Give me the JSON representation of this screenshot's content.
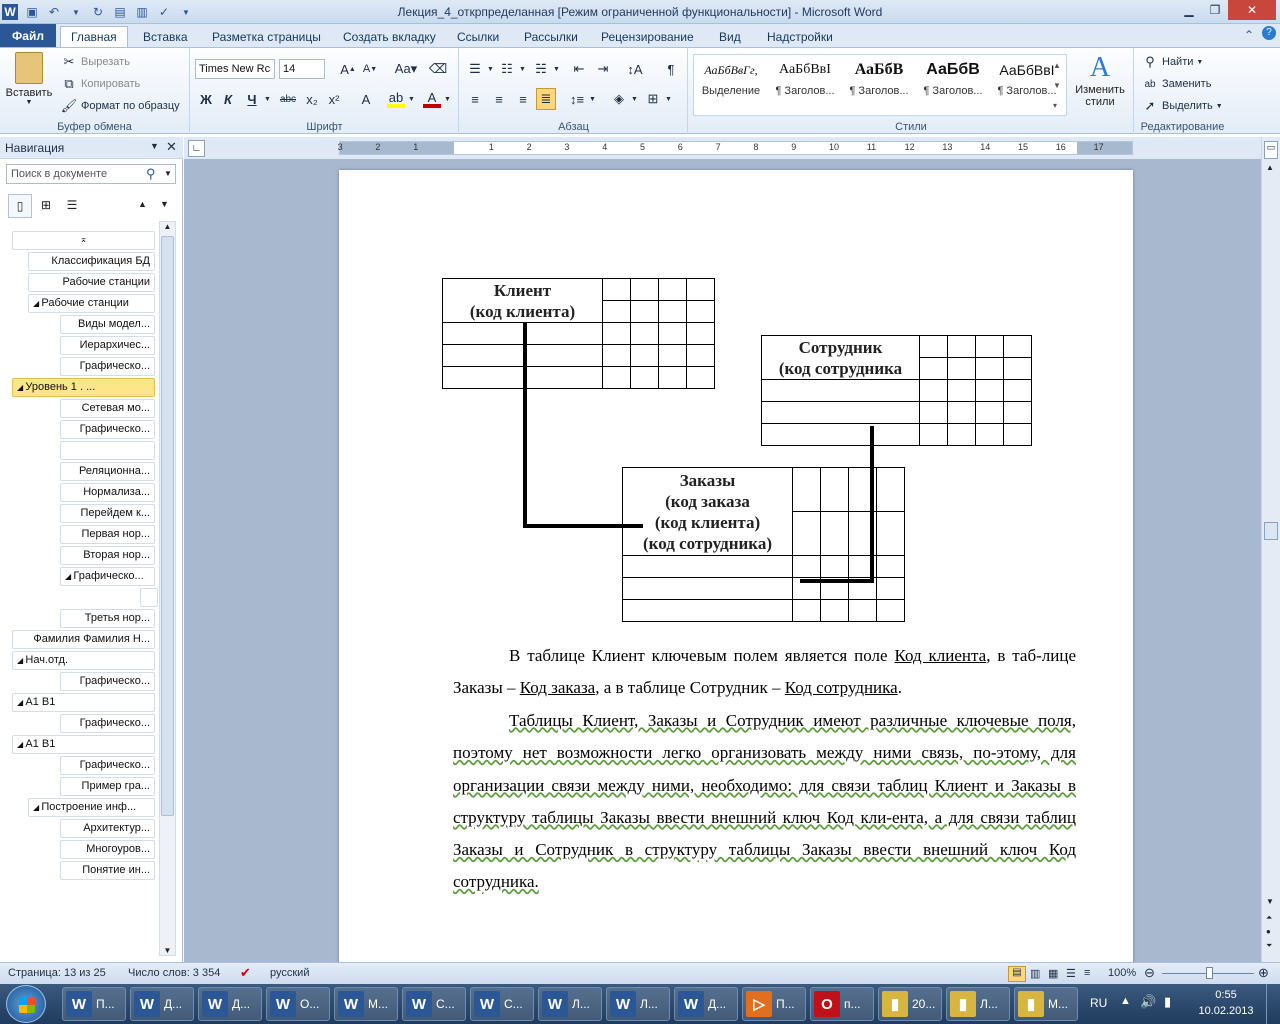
{
  "window": {
    "title": "Лекция_4_открпределанная [Режим ограниченной функциональности] - Microsoft Word"
  },
  "tabs": [
    "Файл",
    "Главная",
    "Вставка",
    "Разметка страницы",
    "Создать вкладку",
    "Ссылки",
    "Рассылки",
    "Рецензирование",
    "Вид",
    "Надстройки"
  ],
  "ribbon": {
    "clipboard": {
      "paste": "Вставить",
      "cut": "Вырезать",
      "copy": "Копировать",
      "format_painter": "Формат по образцу",
      "label": "Буфер обмена"
    },
    "font": {
      "name": "Times New Rc",
      "size": "14",
      "label": "Шрифт"
    },
    "paragraph": {
      "label": "Абзац"
    },
    "styles": {
      "label": "Стили",
      "items": [
        {
          "sample": "АаБбВвГг,",
          "name": "Выделение"
        },
        {
          "sample": "АаБбВвI",
          "name": "¶ Заголов..."
        },
        {
          "sample": "АаБбВ",
          "name": "¶ Заголов..."
        },
        {
          "sample": "АаБбВ",
          "name": "¶ Заголов..."
        },
        {
          "sample": "АаБбВвI",
          "name": "¶ Заголов..."
        }
      ],
      "change": "Изменить стили"
    },
    "editing": {
      "find": "Найти",
      "replace": "Заменить",
      "select": "Выделить",
      "label": "Редактирование"
    }
  },
  "nav": {
    "title": "Навигация",
    "search_placeholder": "Поиск в документе",
    "items": [
      "Классификация БД",
      "Рабочие станции",
      "Рабочие станции",
      "Виды модел...",
      "Иерархичес...",
      "Графическо...",
      "Уровень 1          .         ...",
      "Сетевая мо...",
      "Графическо...",
      "",
      "Реляционна...",
      "Нормализа...",
      "Перейдем к...",
      "Первая нор...",
      "Вторая нор...",
      "Графическо...",
      "",
      "Третья нор...",
      "Фамилия Фамилия Н...",
      "Нач.отд.",
      "Графическо...",
      "А1 В1",
      "Графическо...",
      "А1 В1",
      "Графическо...",
      "Пример гра...",
      "Построение инф...",
      "Архитектур...",
      "Многоуров...",
      "Понятие ин..."
    ]
  },
  "ruler_numbers": [
    "3",
    "2",
    "1",
    "1",
    "2",
    "3",
    "4",
    "5",
    "6",
    "7",
    "8",
    "9",
    "10",
    "11",
    "12",
    "13",
    "14",
    "15",
    "16",
    "17"
  ],
  "diagram": {
    "client": {
      "line1": "Клиент",
      "line2": "(код клиента)"
    },
    "employee": {
      "line1": "Сотрудник",
      "line2": "(код сотрудника"
    },
    "orders": {
      "line1": "Заказы",
      "line2": "(код заказа",
      "line3": "(код клиента)",
      "line4": "(код сотрудника)"
    }
  },
  "text": {
    "p1_a": "В таблице Клиент ключевым полем является поле ",
    "p1_b": "Код клиента",
    "p1_c": ", в таб-лице Заказы – ",
    "p1_d": "Код заказа",
    "p1_e": ", а в таблице Сотрудник – ",
    "p1_f": "Код сотрудника",
    "p1_g": ".",
    "p2": "Таблицы Клиент, Заказы и Сотрудник имеют различные ключевые поля, поэтому нет возможности легко организовать между ними связь, по-этому, для организации связи между ними, необходимо: для связи таблиц Клиент и Заказы в структуру таблицы Заказы ввести внешний ключ Код кли-ента, а для связи таблиц Заказы и Сотрудник в структуру таблицы Заказы ввести внешний ключ Код сотрудника."
  },
  "status": {
    "page": "Страница: 13 из 25",
    "words": "Число слов: 3 354",
    "lang": "русский",
    "zoom": "100%"
  },
  "taskbar": {
    "items": [
      {
        "icon": "W",
        "label": "П..."
      },
      {
        "icon": "W",
        "label": "Д..."
      },
      {
        "icon": "W",
        "label": "Д..."
      },
      {
        "icon": "W",
        "label": "О..."
      },
      {
        "icon": "W",
        "label": "М..."
      },
      {
        "icon": "W",
        "label": "С..."
      },
      {
        "icon": "W",
        "label": "С..."
      },
      {
        "icon": "W",
        "label": "Л..."
      },
      {
        "icon": "W",
        "label": "Л..."
      },
      {
        "icon": "W",
        "label": "Д..."
      },
      {
        "icon": "▷",
        "label": "П..."
      },
      {
        "icon": "O",
        "label": "п..."
      },
      {
        "icon": "▮",
        "label": "20..."
      },
      {
        "icon": "▮",
        "label": "Л..."
      },
      {
        "icon": "▮",
        "label": "М..."
      }
    ],
    "lang": "RU",
    "time": "0:55",
    "date": "10.02.2013"
  },
  "colors": {
    "accent": "#2b5797",
    "selection": "#fde58a",
    "word_icon": "#2b5797"
  }
}
